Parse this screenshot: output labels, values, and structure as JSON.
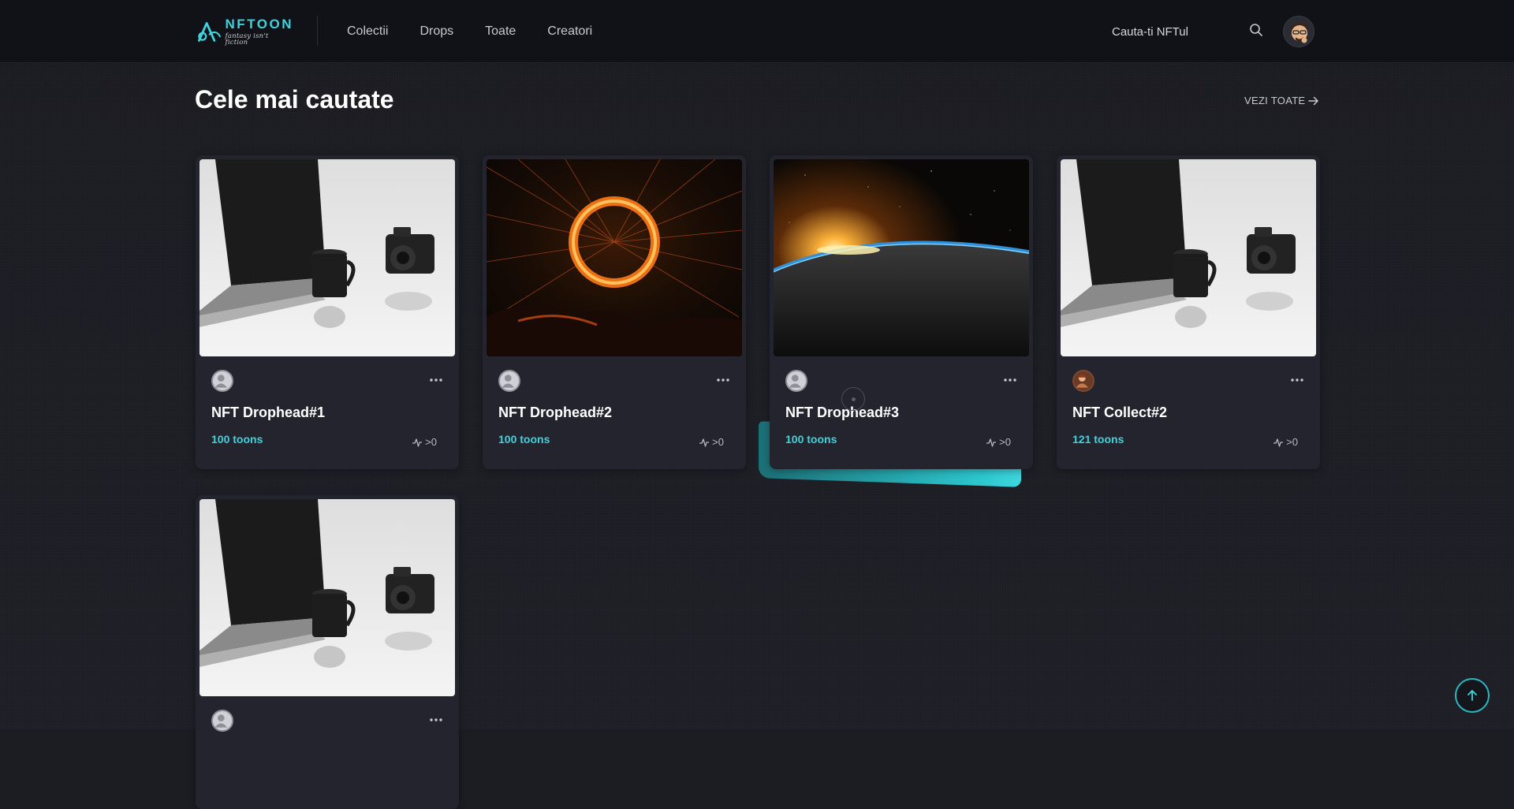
{
  "header": {
    "logo_name": "NFTOON",
    "logo_tagline": "fantasy isn't fiction",
    "nav": [
      {
        "label": "Colectii"
      },
      {
        "label": "Drops"
      },
      {
        "label": "Toate"
      },
      {
        "label": "Creatori"
      }
    ],
    "search_placeholder": "Cauta-ti NFTul"
  },
  "section": {
    "title": "Cele mai cautate",
    "see_all_label": "VEZI TOATE"
  },
  "cards": [
    {
      "title": "NFT Drophead#1",
      "price": "100 toons",
      "activity": ">0",
      "image": "laptop-coffee-camera"
    },
    {
      "title": "NFT Drophead#2",
      "price": "100 toons",
      "activity": ">0",
      "image": "steel-wool-ring"
    },
    {
      "title": "NFT Drophead#3",
      "price": "100 toons",
      "activity": ">0",
      "image": "earth-sunrise"
    },
    {
      "title": "NFT Collect#2",
      "price": "121 toons",
      "activity": ">0",
      "image": "laptop-coffee-camera"
    },
    {
      "title": "",
      "price": "",
      "activity": "",
      "image": "laptop-coffee-camera"
    }
  ],
  "colors": {
    "accent": "#3fd3dc",
    "background": "#1c1d23",
    "card": "#23242e",
    "header": "#111217"
  }
}
